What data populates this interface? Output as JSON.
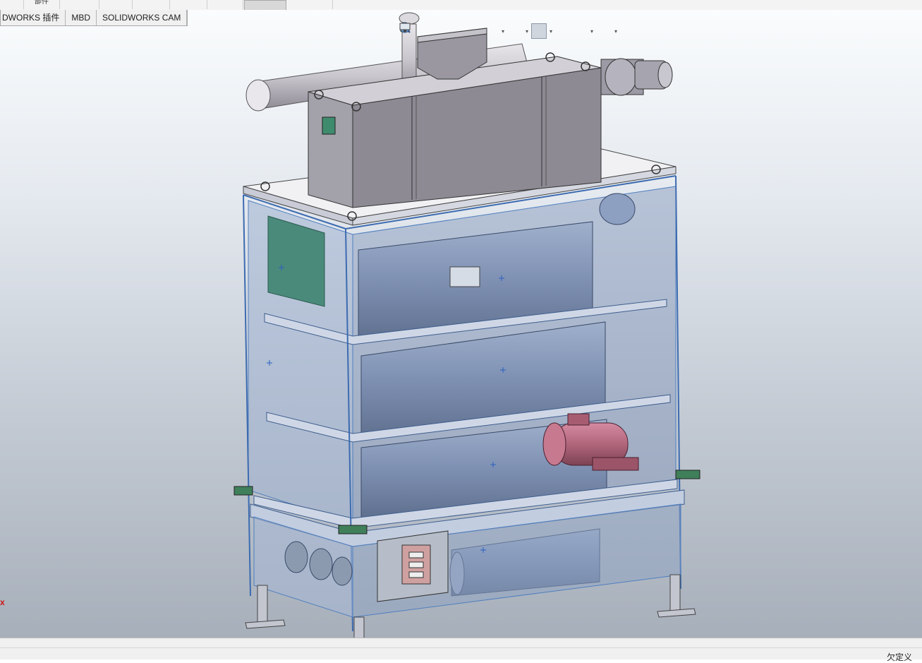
{
  "top_strip": {
    "cells": [
      "",
      "部件",
      "",
      "",
      "",
      "",
      "",
      "",
      ""
    ]
  },
  "tabs": [
    "DWORKS 插件",
    "MBD",
    "SOLIDWORKS CAM"
  ],
  "hud_icons": [
    {
      "name": "zoom-to-fit-icon"
    },
    {
      "name": "zoom-area-icon"
    },
    {
      "name": "previous-view-icon"
    },
    {
      "name": "section-view-icon"
    },
    {
      "name": "dynamic-annotation-icon"
    },
    {
      "name": "view-orientation-icon"
    },
    {
      "name": "display-style-icon"
    },
    {
      "name": "hide-show-items-icon"
    },
    {
      "name": "edit-appearance-icon"
    },
    {
      "name": "apply-scene-icon"
    },
    {
      "name": "view-settings-icon"
    }
  ],
  "status": {
    "text": "欠定义"
  },
  "colors": {
    "frame": "#5f8fc8",
    "panel": "#8fa2c4",
    "hopper": "#8d8c97",
    "motor": "#b3647a",
    "panel_green": "#4a8a7a"
  }
}
